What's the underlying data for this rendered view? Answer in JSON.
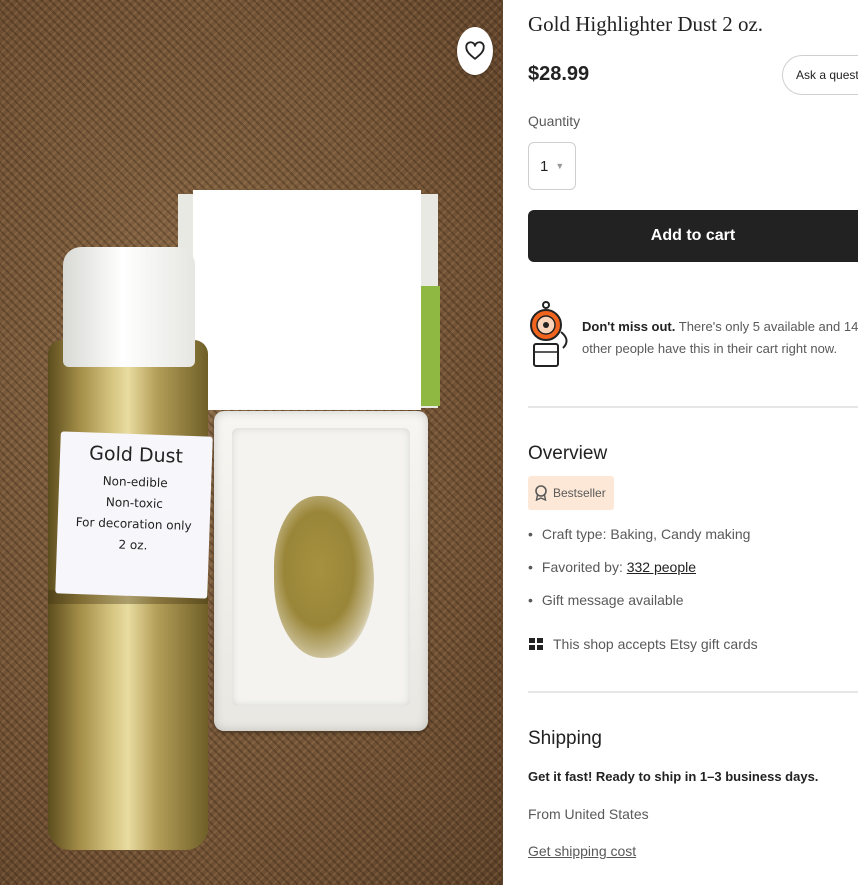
{
  "product_image": {
    "jar_label": {
      "title": "Gold Dust",
      "lines": [
        "Non-edible",
        "Non-toxic",
        "For decoration only",
        "2 oz."
      ]
    }
  },
  "product": {
    "title": "Gold Highlighter Dust 2 oz.",
    "price": "$28.99",
    "ask_question_label": "Ask a question",
    "quantity_label": "Quantity",
    "quantity_value": "1",
    "add_to_cart_label": "Add to cart"
  },
  "scarcity": {
    "bold": "Don't miss out.",
    "text": " There's only 5 available and 14 other people have this in their cart right now."
  },
  "overview": {
    "heading": "Overview",
    "badge": "Bestseller",
    "craft_type": "Craft type: Baking, Candy making",
    "favorited_prefix": "Favorited by: ",
    "favorited_link": "332 people",
    "gift_message": "Gift message available",
    "gift_cards": "This shop accepts Etsy gift cards"
  },
  "shipping": {
    "heading": "Shipping",
    "fast": "Get it fast! Ready to ship in 1–3 business days.",
    "from": "From United States",
    "cost_link": "Get shipping cost"
  },
  "colors": {
    "cart_button": "#222222",
    "badge_background": "#fde8d7",
    "alarm_orange": "#f1641e"
  },
  "icons": [
    "heart-icon",
    "alarm-bell-icon",
    "bestseller-medal-icon",
    "gift-card-icon",
    "chevron-down-icon"
  ]
}
